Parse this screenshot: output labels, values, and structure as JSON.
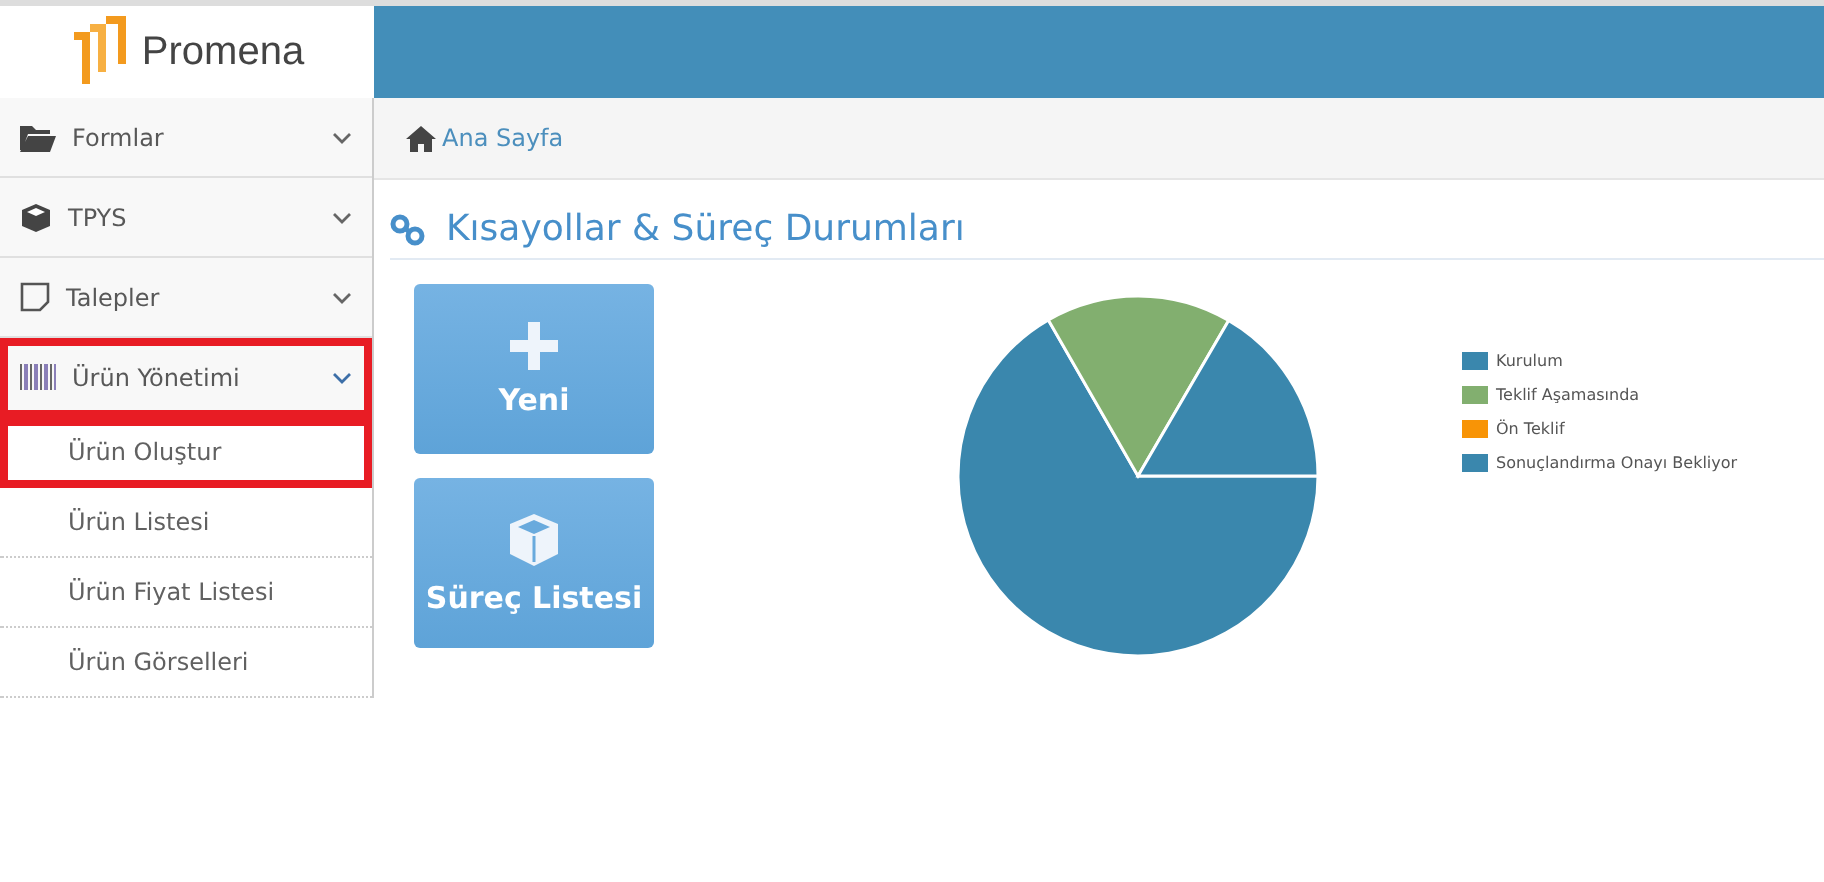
{
  "logo": {
    "text": "Promena"
  },
  "sidebar": {
    "items": [
      {
        "label": "Formlar",
        "expanded": false,
        "highlighted": false
      },
      {
        "label": "TPYS",
        "expanded": false,
        "highlighted": false
      },
      {
        "label": "Talepler",
        "expanded": false,
        "highlighted": false
      },
      {
        "label": "Ürün Yönetimi",
        "expanded": true,
        "highlighted": true,
        "children": [
          {
            "label": "Ürün Oluştur",
            "highlighted": true
          },
          {
            "label": "Ürün Listesi",
            "highlighted": false
          },
          {
            "label": "Ürün Fiyat Listesi",
            "highlighted": false
          },
          {
            "label": "Ürün Görselleri",
            "highlighted": false
          }
        ]
      }
    ]
  },
  "breadcrumb": {
    "label": "Ana Sayfa"
  },
  "section": {
    "title": "Kısayollar & Süreç Durumları",
    "shortcuts": [
      {
        "label": "Yeni"
      },
      {
        "label": "Süreç Listesi"
      }
    ],
    "chart_data": {
      "type": "pie",
      "categories": [
        "Kurulum",
        "Teklif Aşamasında",
        "Ön Teklif",
        "Sonuçlandırma Onayı Bekliyor"
      ],
      "series": [
        {
          "values": [
            66.7,
            16.7,
            0,
            16.6
          ],
          "colors": [
            "#3a87ad",
            "#82af6f",
            "#f89406",
            "#3a87ad"
          ]
        }
      ]
    }
  }
}
